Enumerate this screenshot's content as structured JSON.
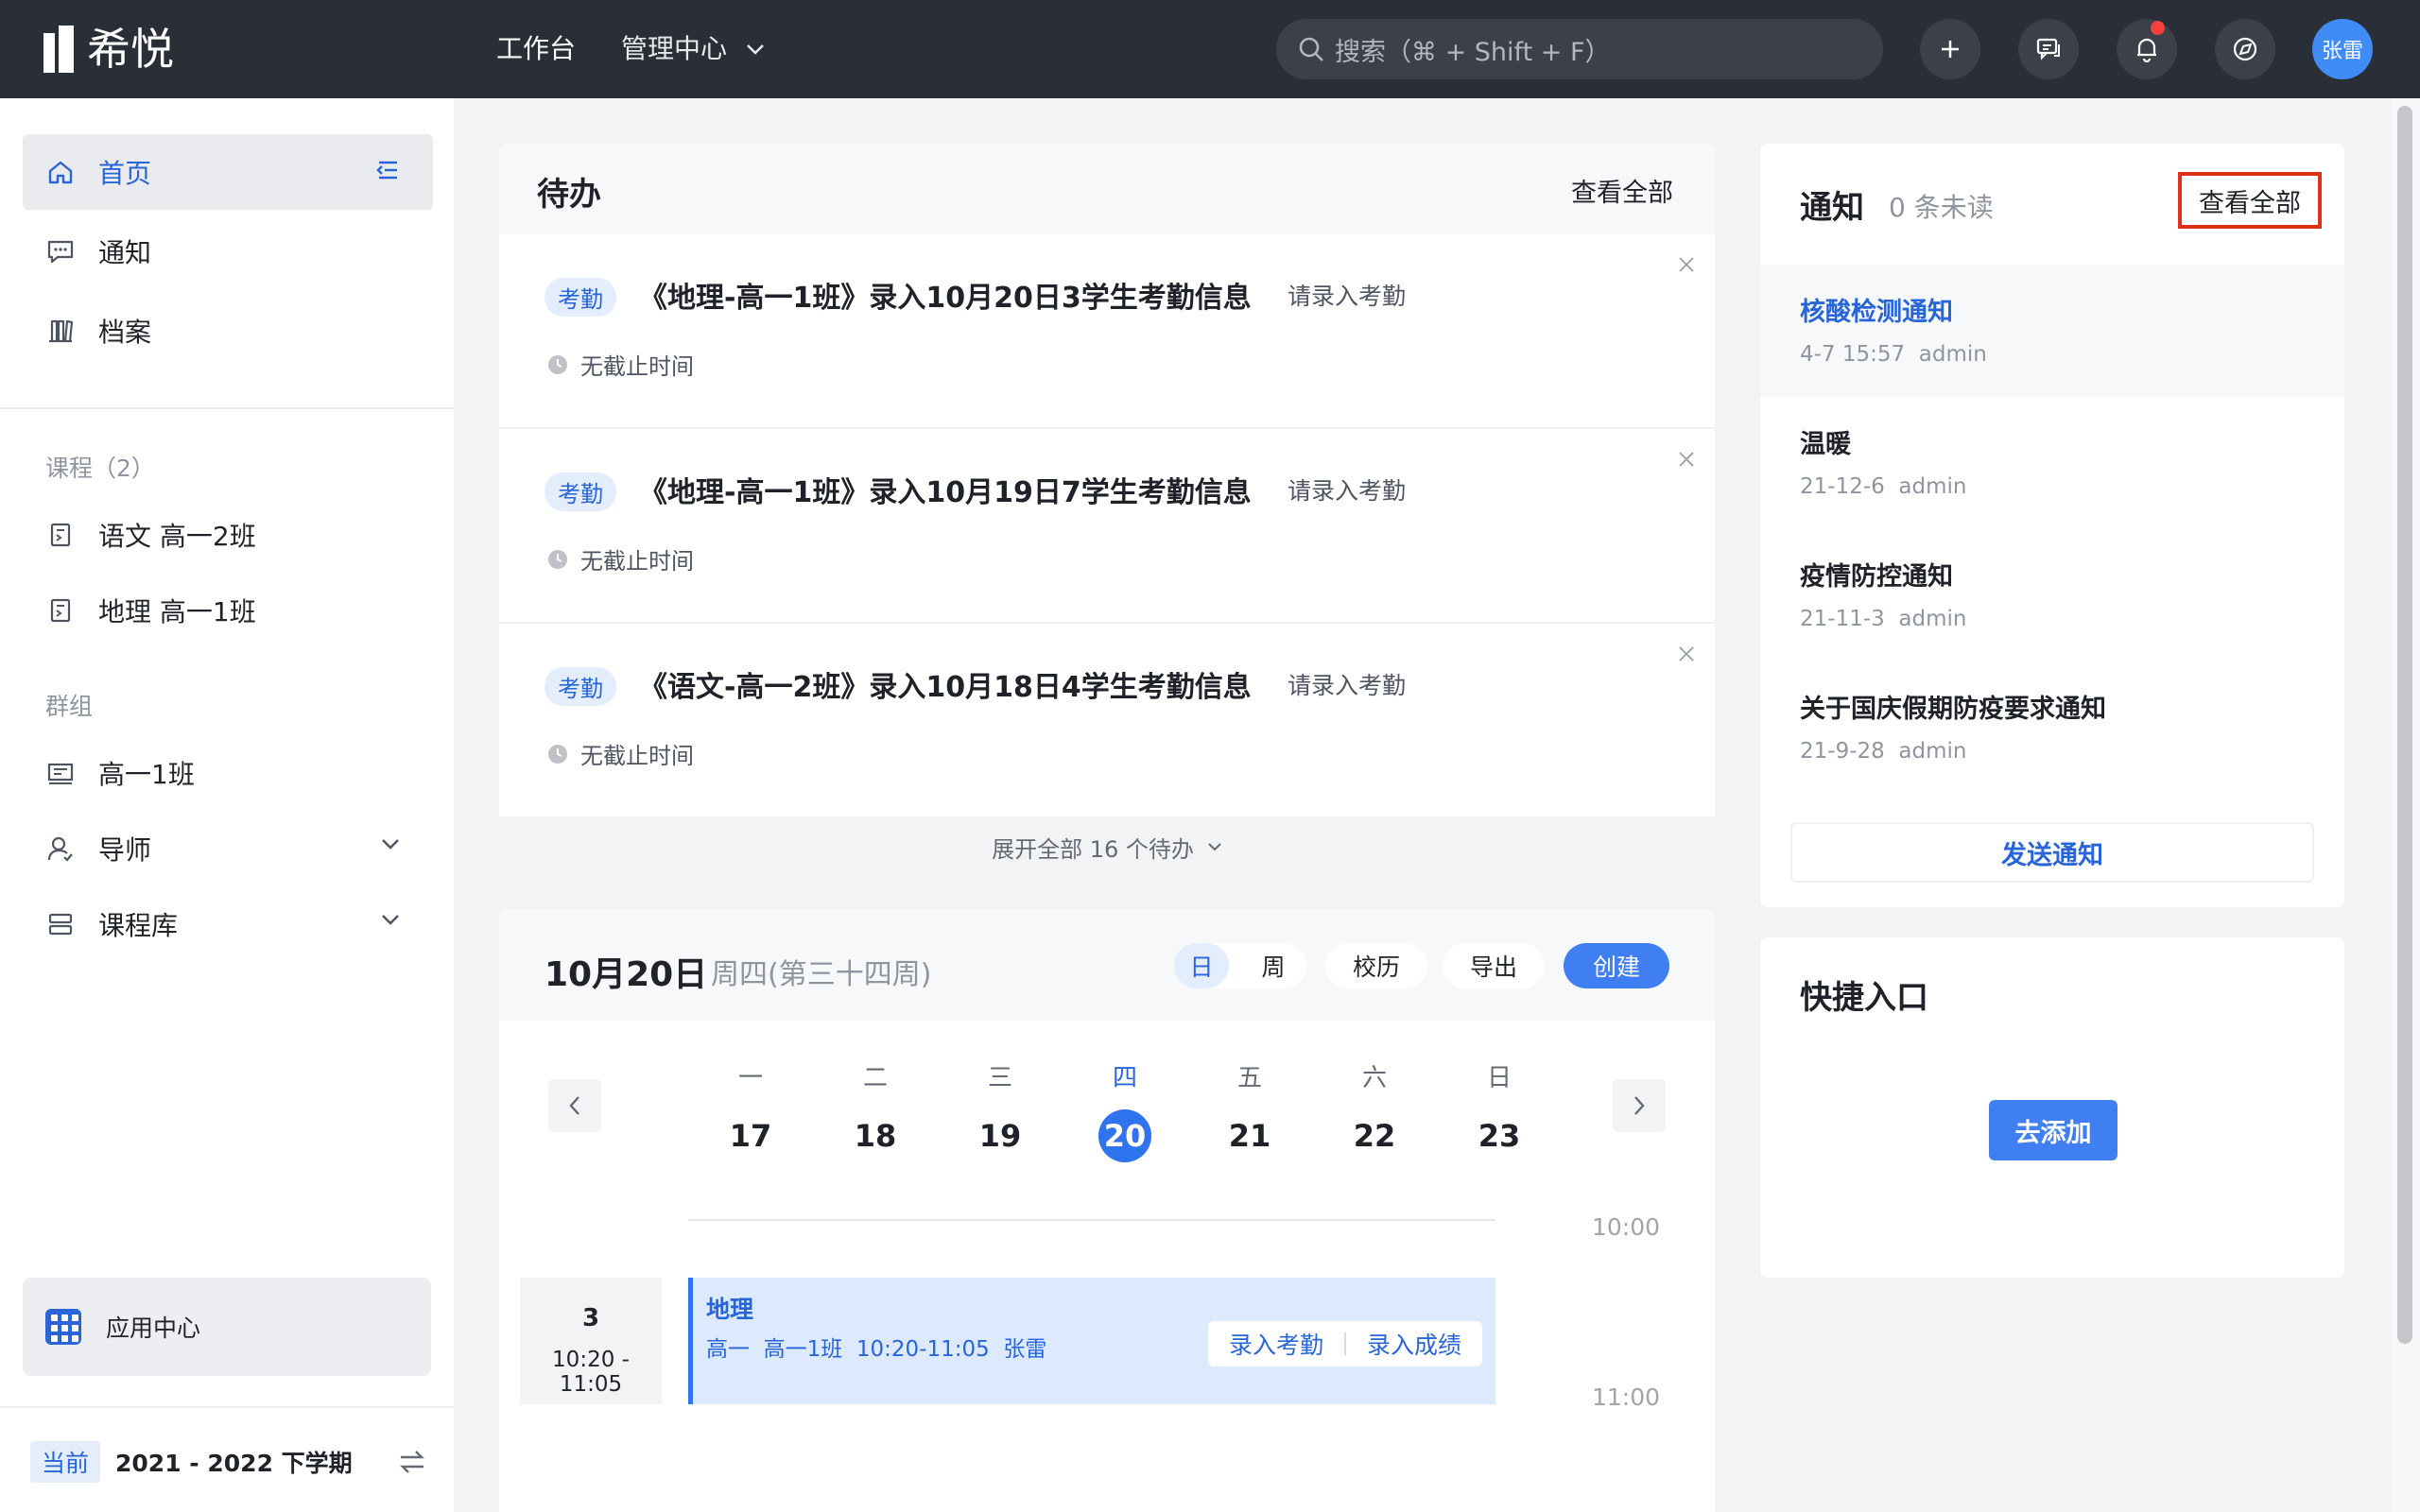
{
  "app": {
    "name": "希悦"
  },
  "topnav": {
    "workbench": "工作台",
    "manage_center": "管理中心",
    "search_placeholder": "搜索（⌘ + Shift + F）",
    "avatar_text": "张雷"
  },
  "sidebar": {
    "main_items": [
      {
        "label": "首页",
        "icon": "home-icon",
        "active": true
      },
      {
        "label": "通知",
        "icon": "message-icon"
      },
      {
        "label": "档案",
        "icon": "archive-icon"
      }
    ],
    "courses_heading": "课程（2）",
    "courses": [
      {
        "label": "语文 高一2班",
        "icon": "book-icon"
      },
      {
        "label": "地理 高一1班",
        "icon": "book-icon"
      }
    ],
    "groups_heading": "群组",
    "groups": [
      {
        "label": "高一1班",
        "icon": "class-icon"
      },
      {
        "label": "导师",
        "icon": "mentor-icon"
      },
      {
        "label": "课程库",
        "icon": "library-icon"
      }
    ],
    "app_center": "应用中心",
    "term_tag": "当前",
    "term": "2021 - 2022 下学期"
  },
  "todo": {
    "title": "待办",
    "view_all": "查看全部",
    "items": [
      {
        "badge": "考勤",
        "title": "《地理-高一1班》录入10月20日3学生考勤信息",
        "action": "请录入考勤",
        "deadline": "无截止时间"
      },
      {
        "badge": "考勤",
        "title": "《地理-高一1班》录入10月19日7学生考勤信息",
        "action": "请录入考勤",
        "deadline": "无截止时间"
      },
      {
        "badge": "考勤",
        "title": "《语文-高一2班》录入10月18日4学生考勤信息",
        "action": "请录入考勤",
        "deadline": "无截止时间"
      }
    ],
    "expand": "展开全部 16 个待办"
  },
  "calendar": {
    "date": "10月20日",
    "weekday": "周四(第三十四周)",
    "view_day": "日",
    "view_week": "周",
    "school_calendar": "校历",
    "export": "导出",
    "create": "创建",
    "days": [
      {
        "weekday": "一",
        "date": "17"
      },
      {
        "weekday": "二",
        "date": "18"
      },
      {
        "weekday": "三",
        "date": "19"
      },
      {
        "weekday": "四",
        "date": "20",
        "today": true
      },
      {
        "weekday": "五",
        "date": "21"
      },
      {
        "weekday": "六",
        "date": "22"
      },
      {
        "weekday": "日",
        "date": "23"
      }
    ],
    "times": [
      "10:00",
      "11:00"
    ],
    "period": {
      "number": "3",
      "time": "10:20 - 11:05"
    },
    "event": {
      "name": "地理",
      "detail": "高一  高一1班  10:20-11:05  张雷",
      "action_attendance": "录入考勤",
      "action_grades": "录入成绩"
    }
  },
  "notice": {
    "title": "通知",
    "unread": "0 条未读",
    "view_all": "查看全部",
    "items": [
      {
        "title": "核酸检测通知",
        "meta": "4-7 15:57  admin",
        "highlight": true
      },
      {
        "title": "温暖",
        "meta": "21-12-6  admin"
      },
      {
        "title": "疫情防控通知",
        "meta": "21-11-3  admin"
      },
      {
        "title": "关于国庆假期防疫要求通知",
        "meta": "21-9-28  admin"
      }
    ],
    "send": "发送通知"
  },
  "quick": {
    "title": "快捷入口",
    "add": "去添加"
  },
  "colors": {
    "topbar": "#2a2e36",
    "accent": "#3f7ff1",
    "notification_dot": "#f5403d",
    "highlight_box": "#e0301e"
  }
}
